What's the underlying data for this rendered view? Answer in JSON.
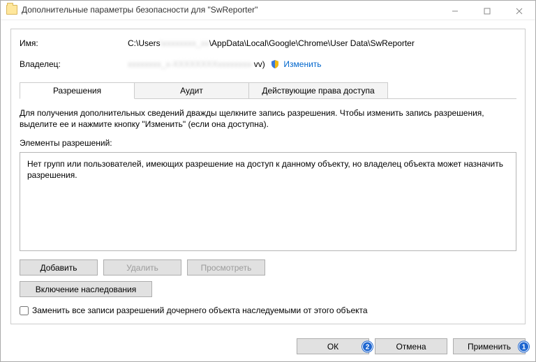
{
  "titlebar": {
    "title": "Дополнительные параметры безопасности  для \"SwReporter\""
  },
  "info": {
    "name_label": "Имя:",
    "name_prefix": "C:\\Users",
    "name_blurred": "\\xxxxxxxx_xx",
    "name_suffix": "\\AppData\\Local\\Google\\Chrome\\User Data\\SwReporter",
    "owner_label": "Владелец:",
    "owner_blurred": "xxxxxxxx_x-XXXXXXXXxxxxxxxx-",
    "owner_suffix": "vv)",
    "change_link": "Изменить"
  },
  "tabs": {
    "permissions": "Разрешения",
    "audit": "Аудит",
    "effective": "Действующие права доступа"
  },
  "body": {
    "help_text": "Для получения дополнительных сведений дважды щелкните запись разрешения. Чтобы изменить запись разрешения, выделите ее и нажмите кнопку \"Изменить\" (если она доступна).",
    "elements_label": "Элементы разрешений:",
    "empty_text": "Нет групп или пользователей, имеющих разрешение на доступ к данному объекту, но владелец объекта может назначить разрешения."
  },
  "buttons": {
    "add": "Добавить",
    "delete": "Удалить",
    "view": "Просмотреть",
    "inherit": "Включение наследования",
    "replace_checkbox": "Заменить все записи разрешений дочернего объекта наследуемыми от этого объекта"
  },
  "footer": {
    "ok": "ОК",
    "cancel": "Отмена",
    "apply": "Применить",
    "badge_ok": "2",
    "badge_apply": "1"
  }
}
